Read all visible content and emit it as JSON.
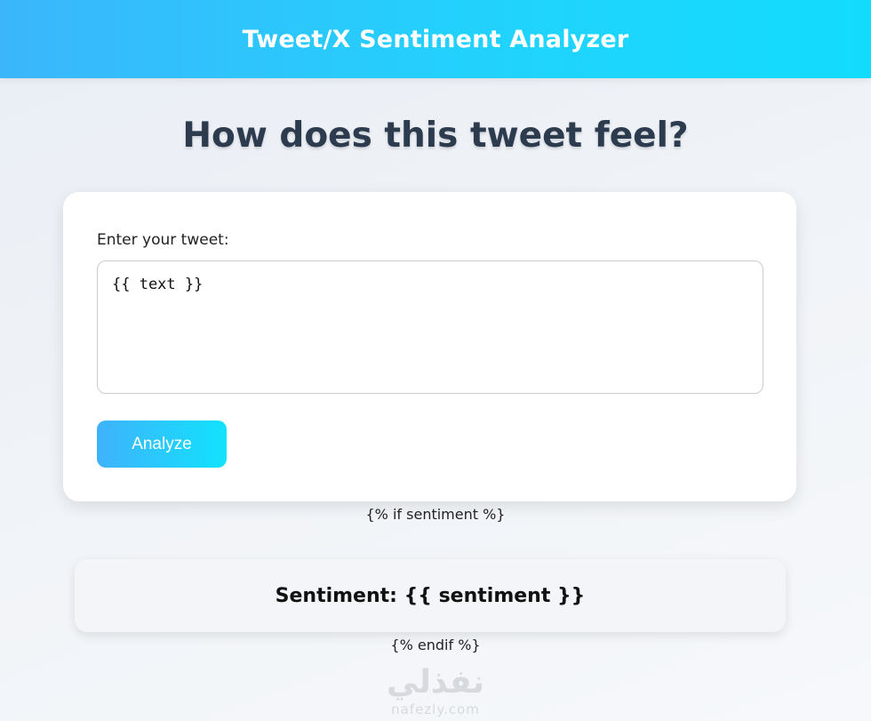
{
  "header": {
    "title": "Tweet/X Sentiment Analyzer"
  },
  "main": {
    "heading": "How does this tweet feel?",
    "form": {
      "label": "Enter your tweet:",
      "textarea_value": "{{ text }}",
      "submit_label": "Analyze"
    },
    "template_if": "{% if sentiment %}",
    "result": {
      "text": "Sentiment: {{ sentiment }}"
    },
    "template_endif": "{% endif %}"
  },
  "watermark": {
    "logo": "نفذلي",
    "domain": "nafezly.com"
  },
  "colors": {
    "header_gradient_start": "#3bb6fb",
    "header_gradient_end": "#12dcfd",
    "button_gradient_start": "#3fb2fb",
    "button_gradient_end": "#12e2fd",
    "heading_text": "#2d3b4e"
  }
}
